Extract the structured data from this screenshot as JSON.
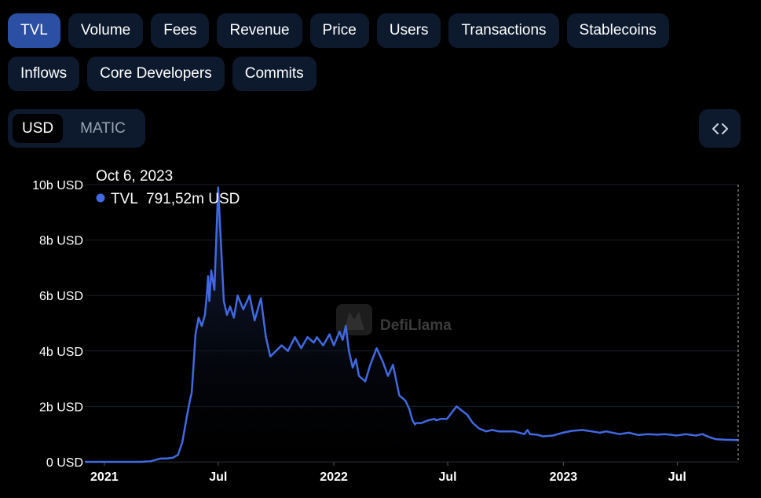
{
  "tabs_row1": [
    "TVL",
    "Volume",
    "Fees",
    "Revenue",
    "Price",
    "Users",
    "Transactions",
    "Stablecoins"
  ],
  "tabs_row2": [
    "Inflows",
    "Core Developers",
    "Commits"
  ],
  "active_tab": "TVL",
  "unit_toggle": {
    "options": [
      "USD",
      "MATIC"
    ],
    "selected": "USD"
  },
  "embed_icon": "code-brackets-icon",
  "colors": {
    "accent": "#4169e1",
    "tab_bg": "#0d1a2e",
    "tab_active": "#2a4fa3"
  },
  "tooltip": {
    "date": "Oct 6, 2023",
    "series": "TVL",
    "value": "791,52m USD"
  },
  "watermark": "DefiLlama",
  "chart_data": {
    "type": "area",
    "series": [
      {
        "name": "TVL",
        "x": [
          "2020-12-01",
          "2020-12-31",
          "2021-01-31",
          "2021-02-28",
          "2021-03-15",
          "2021-03-31",
          "2021-04-10",
          "2021-04-20",
          "2021-04-28",
          "2021-05-05",
          "2021-05-12",
          "2021-05-17",
          "2021-05-20",
          "2021-05-23",
          "2021-05-26",
          "2021-05-31",
          "2021-06-05",
          "2021-06-10",
          "2021-06-13",
          "2021-06-15",
          "2021-06-17",
          "2021-06-20",
          "2021-06-25",
          "2021-07-01",
          "2021-07-10",
          "2021-07-15",
          "2021-07-20",
          "2021-07-26",
          "2021-08-01",
          "2021-08-10",
          "2021-08-20",
          "2021-08-28",
          "2021-09-07",
          "2021-09-15",
          "2021-09-22",
          "2021-10-01",
          "2021-10-10",
          "2021-10-20",
          "2021-10-31",
          "2021-11-10",
          "2021-11-20",
          "2021-11-30",
          "2021-12-05",
          "2021-12-15",
          "2021-12-25",
          "2022-01-01",
          "2022-01-10",
          "2022-01-15",
          "2022-01-20",
          "2022-01-25",
          "2022-01-31",
          "2022-02-05",
          "2022-02-10",
          "2022-02-20",
          "2022-02-28",
          "2022-03-10",
          "2022-03-20",
          "2022-03-28",
          "2022-04-05",
          "2022-04-15",
          "2022-04-25",
          "2022-05-01",
          "2022-05-06",
          "2022-05-10",
          "2022-05-12",
          "2022-05-20",
          "2022-05-31",
          "2022-06-10",
          "2022-06-13",
          "2022-06-20",
          "2022-06-30",
          "2022-07-15",
          "2022-08-01",
          "2022-08-10",
          "2022-08-20",
          "2022-08-31",
          "2022-09-10",
          "2022-09-20",
          "2022-09-30",
          "2022-10-15",
          "2022-10-31",
          "2022-11-05",
          "2022-11-09",
          "2022-11-20",
          "2022-11-30",
          "2022-12-15",
          "2022-12-31",
          "2023-01-15",
          "2023-01-31",
          "2023-02-15",
          "2023-02-28",
          "2023-03-10",
          "2023-03-31",
          "2023-04-15",
          "2023-04-30",
          "2023-05-15",
          "2023-05-31",
          "2023-06-10",
          "2023-06-20",
          "2023-06-30",
          "2023-07-15",
          "2023-07-31",
          "2023-08-10",
          "2023-08-20",
          "2023-08-31",
          "2023-09-15",
          "2023-09-30",
          "2023-10-06"
        ],
        "values": [
          0.0,
          0.0,
          0.0,
          0.0,
          0.02,
          0.12,
          0.12,
          0.15,
          0.25,
          0.7,
          1.6,
          2.2,
          2.5,
          3.5,
          4.6,
          5.2,
          4.9,
          5.3,
          6.0,
          6.7,
          5.8,
          6.9,
          6.2,
          9.9,
          5.8,
          5.3,
          5.6,
          5.2,
          6.0,
          5.5,
          6.0,
          5.1,
          5.9,
          4.5,
          3.8,
          4.0,
          4.2,
          4.0,
          4.5,
          4.1,
          4.5,
          4.3,
          4.5,
          4.2,
          4.6,
          4.2,
          4.7,
          4.4,
          4.9,
          4.0,
          3.4,
          3.7,
          3.1,
          2.9,
          3.5,
          4.1,
          3.6,
          3.1,
          3.5,
          2.4,
          2.2,
          1.9,
          1.5,
          1.35,
          1.4,
          1.4,
          1.5,
          1.55,
          1.5,
          1.55,
          1.55,
          2.0,
          1.7,
          1.4,
          1.2,
          1.1,
          1.15,
          1.1,
          1.1,
          1.1,
          1.0,
          1.15,
          1.0,
          0.98,
          0.92,
          0.95,
          1.05,
          1.12,
          1.15,
          1.1,
          1.05,
          1.1,
          1.0,
          1.05,
          0.97,
          1.0,
          0.98,
          1.0,
          0.98,
          0.95,
          1.0,
          0.95,
          1.0,
          0.9,
          0.82,
          0.8,
          0.79,
          0.79
        ]
      }
    ],
    "y_ticks": [
      "0 USD",
      "2b USD",
      "4b USD",
      "6b USD",
      "8b USD",
      "10b USD"
    ],
    "ylim": [
      0,
      10
    ],
    "x_ticks": [
      "2021",
      "Jul",
      "2022",
      "Jul",
      "2023",
      "Jul"
    ],
    "x_tick_dates": [
      "2021-01-01",
      "2021-07-01",
      "2022-01-01",
      "2022-07-01",
      "2023-01-01",
      "2023-07-01"
    ],
    "xlim": [
      "2020-12-01",
      "2023-10-06"
    ],
    "grid": true,
    "legend": "tooltip top-left"
  }
}
